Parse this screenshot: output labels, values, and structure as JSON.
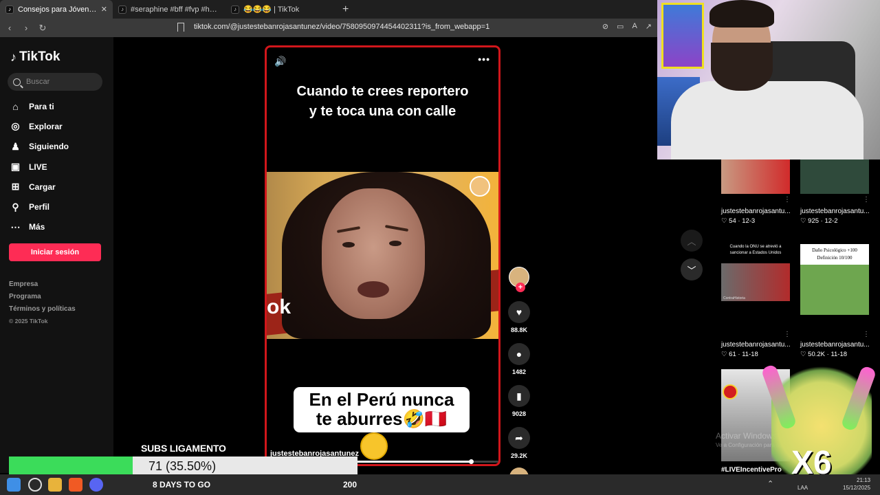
{
  "browser": {
    "tabs": [
      {
        "label": "Consejos para Jóvenes en Perú",
        "active": true
      },
      {
        "label": "#seraphine #bff #fvp #humor #mejo",
        "active": false
      },
      {
        "label": "😂😂😂 | TikTok",
        "active": false
      }
    ],
    "url": "tiktok.com/@justestebanrojasantunez/video/7580950974454402311?is_from_webapp=1"
  },
  "sidebar": {
    "logo": "TikTok",
    "search_placeholder": "Buscar",
    "nav": [
      {
        "label": "Para ti",
        "icon": "home-icon"
      },
      {
        "label": "Explorar",
        "icon": "compass-icon"
      },
      {
        "label": "Siguiendo",
        "icon": "following-icon"
      },
      {
        "label": "LIVE",
        "icon": "live-icon"
      },
      {
        "label": "Cargar",
        "icon": "upload-icon"
      },
      {
        "label": "Perfil",
        "icon": "profile-icon"
      },
      {
        "label": "Más",
        "icon": "more-icon"
      }
    ],
    "login_label": "Iniciar sesión",
    "footer": [
      "Empresa",
      "Programa",
      "Términos y políticas",
      "© 2025 TikTok"
    ]
  },
  "video": {
    "caption_line1": "Cuando te crees reportero",
    "caption_line2": "y te toca una con calle",
    "subtitle_line1": "En el Perú nunca",
    "subtitle_line2": "te aburres🤣🇵🇪",
    "author": "justestebanrojasantunez",
    "progress": 0.88
  },
  "actions": {
    "likes": "88.8K",
    "comments": "1482",
    "saves": "9028",
    "shares": "29.2K"
  },
  "grid": [
    {
      "author": "justestebanrojasantu...",
      "likes": "54",
      "date": "12-3"
    },
    {
      "author": "justestebanrojasantu...",
      "likes": "925",
      "date": "12-2"
    },
    {
      "author": "justestebanrojasantu...",
      "likes": "61",
      "date": "11-18",
      "thumb_text_1": "Cuando la ONU se atrevió a",
      "thumb_text_2": "sancionar a Estados Unidos",
      "thumb_tag": "ContraHistoria"
    },
    {
      "author": "justestebanrojasantu...",
      "likes": "50.2K",
      "date": "11-18",
      "thumb_text_1": "Daño Psicológico +100",
      "thumb_text_2": "Definición 10/100"
    },
    {
      "author": "#LIVEIncentivePro"
    }
  ],
  "watermark": {
    "line1": "Activar Windows",
    "line2": "Ve a Configuración para activar"
  },
  "overlay": {
    "goal_label": "SUBS LIGAMENTO",
    "goal_progress": "71 (35.50%)",
    "goal_fraction": 0.355,
    "countdown": "8 DAYS TO GO",
    "goal_target": "200",
    "multiplier": "X6"
  },
  "taskbar": {
    "lang": "LAA",
    "time": "21:13",
    "date": "15/12/2025"
  }
}
